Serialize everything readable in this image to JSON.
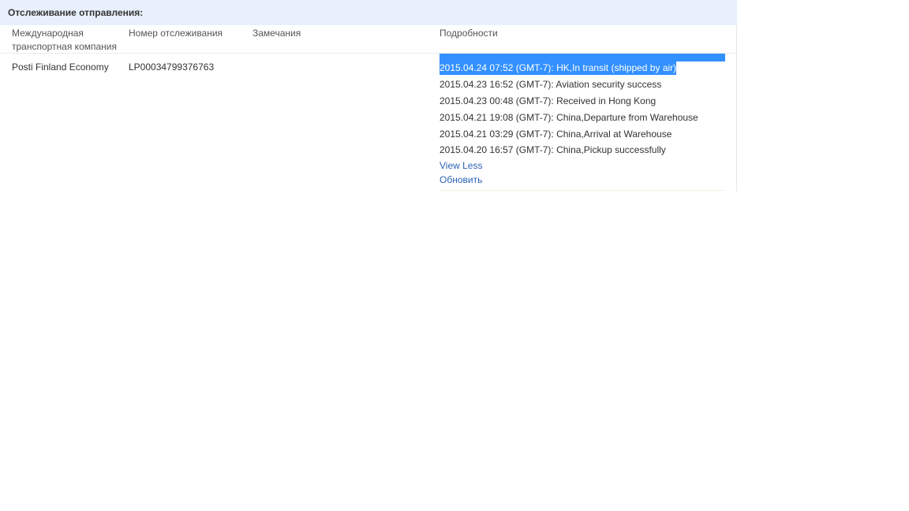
{
  "panel": {
    "title": "Отслеживание отправления:"
  },
  "table": {
    "headers": {
      "carrier": "Международная транспортная компания",
      "tracking": "Номер отслеживания",
      "notes": "Замечания",
      "details": "Подробности"
    },
    "row": {
      "carrier": "Posti Finland Economy",
      "tracking": "LP00034799376763",
      "notes": ""
    }
  },
  "events": [
    {
      "text": "2015.04.24 07:52 (GMT-7): HK,In transit (shipped by air)",
      "selected": true
    },
    {
      "text": "2015.04.23 16:52 (GMT-7): Aviation security success",
      "selected": false
    },
    {
      "text": "2015.04.23 00:48 (GMT-7): Received in Hong Kong",
      "selected": false
    },
    {
      "text": "2015.04.21 19:08 (GMT-7): China,Departure from Warehouse",
      "selected": false
    },
    {
      "text": "2015.04.21 03:29 (GMT-7): China,Arrival at Warehouse",
      "selected": false
    },
    {
      "text": "2015.04.20 16:57 (GMT-7): China,Pickup successfully",
      "selected": false
    }
  ],
  "links": {
    "view_less": "View Less",
    "refresh": "Обновить"
  },
  "colors": {
    "header_bg": "#e8f0fb",
    "selection": "#3390ff",
    "link": "#2a62b4"
  }
}
